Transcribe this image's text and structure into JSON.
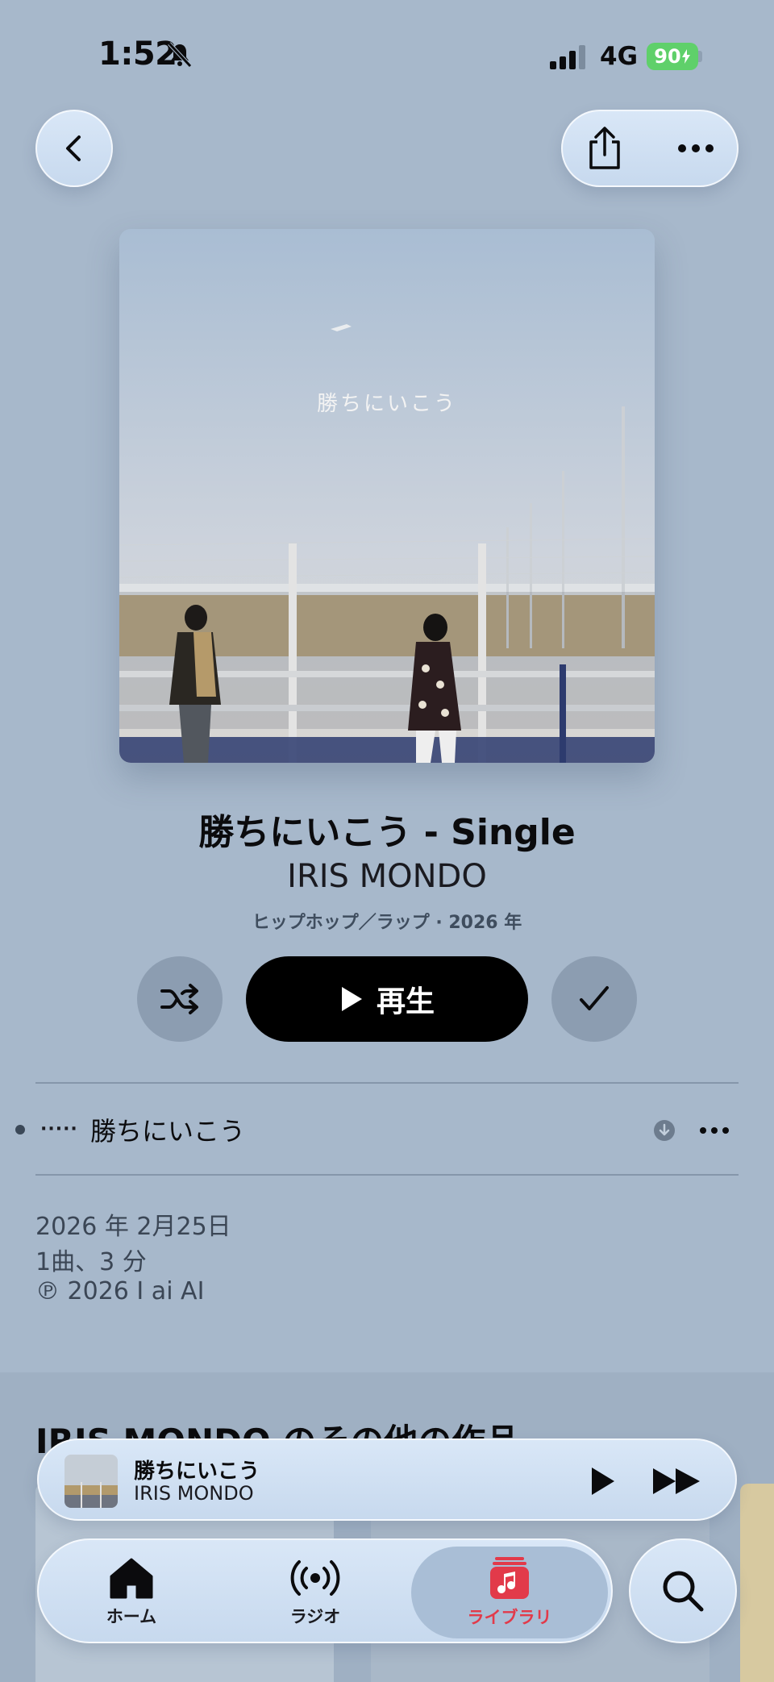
{
  "status_bar": {
    "time": "1:52",
    "network": "4G",
    "battery": "90"
  },
  "album": {
    "cover_text": "勝ちにいこう",
    "title": "勝ちにいこう - Single",
    "artist": "IRIS MONDO",
    "genre_year": "ヒップホップ／ラップ · 2026 年"
  },
  "actions": {
    "play_label": "再生"
  },
  "tracks": [
    {
      "title": "勝ちにいこう",
      "now_playing": "·····"
    }
  ],
  "details": {
    "release_date": "2026 年 2月25日",
    "track_count": "1曲、3 分",
    "copyright": "℗ 2026 I ai AI"
  },
  "more_section": {
    "heading": "IRIS MONDO のその他の作品"
  },
  "mini_player": {
    "title": "勝ちにいこう",
    "artist": "IRIS MONDO"
  },
  "tabs": [
    {
      "label": "ホーム",
      "icon": "home-icon"
    },
    {
      "label": "ラジオ",
      "icon": "radio-icon"
    },
    {
      "label": "ライブラリ",
      "icon": "library-icon",
      "active": true
    }
  ],
  "colors": {
    "background": "#a7b8cb",
    "accent": "#e23a4a",
    "battery": "#5fd06a"
  }
}
